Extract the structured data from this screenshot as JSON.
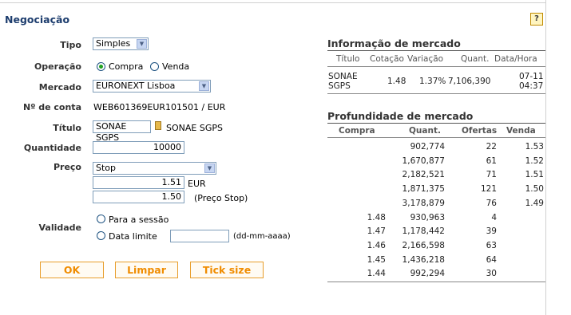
{
  "page": {
    "title": "Negociação",
    "help_label": "?"
  },
  "form": {
    "tipo": {
      "label": "Tipo",
      "value": "Simples"
    },
    "operacao": {
      "label": "Operação",
      "options": [
        "Compra",
        "Venda"
      ],
      "selected": "Compra"
    },
    "mercado": {
      "label": "Mercado",
      "value": "EURONEXT Lisboa"
    },
    "conta": {
      "label": "Nº de conta",
      "value": "WEB601369EUR101501 / EUR"
    },
    "titulo": {
      "label": "Título",
      "input_value": "SONAE SGPS",
      "name": "SONAE SGPS"
    },
    "quantidade": {
      "label": "Quantidade",
      "value": "10000"
    },
    "preco": {
      "label": "Preço",
      "type_value": "Stop",
      "price": "1.51",
      "price_unit": "EUR",
      "stop": "1.50",
      "stop_note": "(Preço Stop)"
    },
    "validade": {
      "label": "Validade",
      "option_session": "Para a sessão",
      "option_date": "Data limite",
      "date_value": "",
      "date_format": "(dd-mm-aaaa)"
    }
  },
  "buttons": {
    "ok": "OK",
    "limpar": "Limpar",
    "tick": "Tick size"
  },
  "market_info": {
    "title": "Informação de mercado",
    "headers": [
      "Título",
      "Cotação",
      "Variação",
      "Quant.",
      "Data/Hora"
    ],
    "row": {
      "titulo_l1": "SONAE",
      "titulo_l2": "SGPS",
      "cotacao": "1.48",
      "variacao": "1.37%",
      "quant": "7,106,390",
      "data": "07-11",
      "hora": "04:37"
    }
  },
  "depth": {
    "title": "Profundidade de mercado",
    "headers": [
      "Compra",
      "Quant.",
      "Ofertas",
      "Venda"
    ],
    "rows": [
      {
        "compra": "",
        "quant": "902,774",
        "ofertas": "22",
        "venda": "1.53"
      },
      {
        "compra": "",
        "quant": "1,670,877",
        "ofertas": "61",
        "venda": "1.52"
      },
      {
        "compra": "",
        "quant": "2,182,521",
        "ofertas": "71",
        "venda": "1.51"
      },
      {
        "compra": "",
        "quant": "1,871,375",
        "ofertas": "121",
        "venda": "1.50"
      },
      {
        "compra": "",
        "quant": "3,178,879",
        "ofertas": "76",
        "venda": "1.49"
      },
      {
        "compra": "1.48",
        "quant": "930,963",
        "ofertas": "4",
        "venda": ""
      },
      {
        "compra": "1.47",
        "quant": "1,178,442",
        "ofertas": "39",
        "venda": ""
      },
      {
        "compra": "1.46",
        "quant": "2,166,598",
        "ofertas": "63",
        "venda": ""
      },
      {
        "compra": "1.45",
        "quant": "1,436,218",
        "ofertas": "64",
        "venda": ""
      },
      {
        "compra": "1.44",
        "quant": "992,294",
        "ofertas": "30",
        "venda": ""
      }
    ]
  }
}
